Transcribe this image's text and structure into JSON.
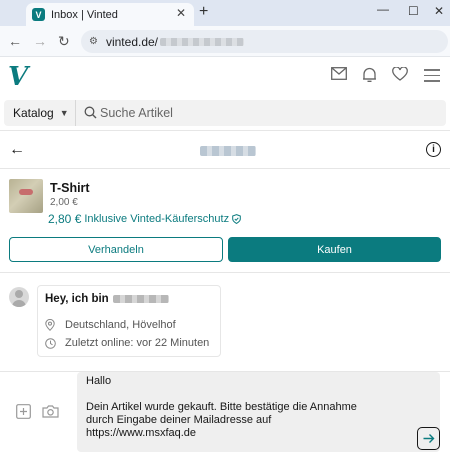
{
  "browser": {
    "tab_title": "Inbox | Vinted",
    "favicon_letter": "V",
    "new_tab": "+",
    "url": "vinted.de/"
  },
  "header": {
    "logo": "V",
    "catalog_label": "Katalog",
    "search_placeholder": "Suche Artikel"
  },
  "item": {
    "title": "T-Shirt",
    "price": "2,00 €",
    "total_amount": "2,80 €",
    "total_note": "Inklusive Vinted-Käuferschutz"
  },
  "actions": {
    "negotiate_label": "Verhandeln",
    "buy_label": "Kaufen"
  },
  "profile_card": {
    "greeting": "Hey, ich bin",
    "location": "Deutschland, Hövelhof",
    "last_online": "Zuletzt online: vor 22 Minuten"
  },
  "composer": {
    "message": "Hallo\n\nDein Artikel wurde gekauft. Bitte bestätige die Annahme\ndurch Eingabe deiner Mailadresse auf\nhttps://www.msxfaq.de"
  },
  "colors": {
    "brand": "#0b7b7f",
    "text": "#171717",
    "muted": "#666666"
  },
  "icons": [
    "mail-icon",
    "bell-icon",
    "heart-icon",
    "menu-icon",
    "search-icon",
    "back-arrow-icon",
    "info-icon",
    "shield-icon",
    "location-icon",
    "clock-icon",
    "add-image-icon",
    "camera-icon",
    "send-icon"
  ]
}
